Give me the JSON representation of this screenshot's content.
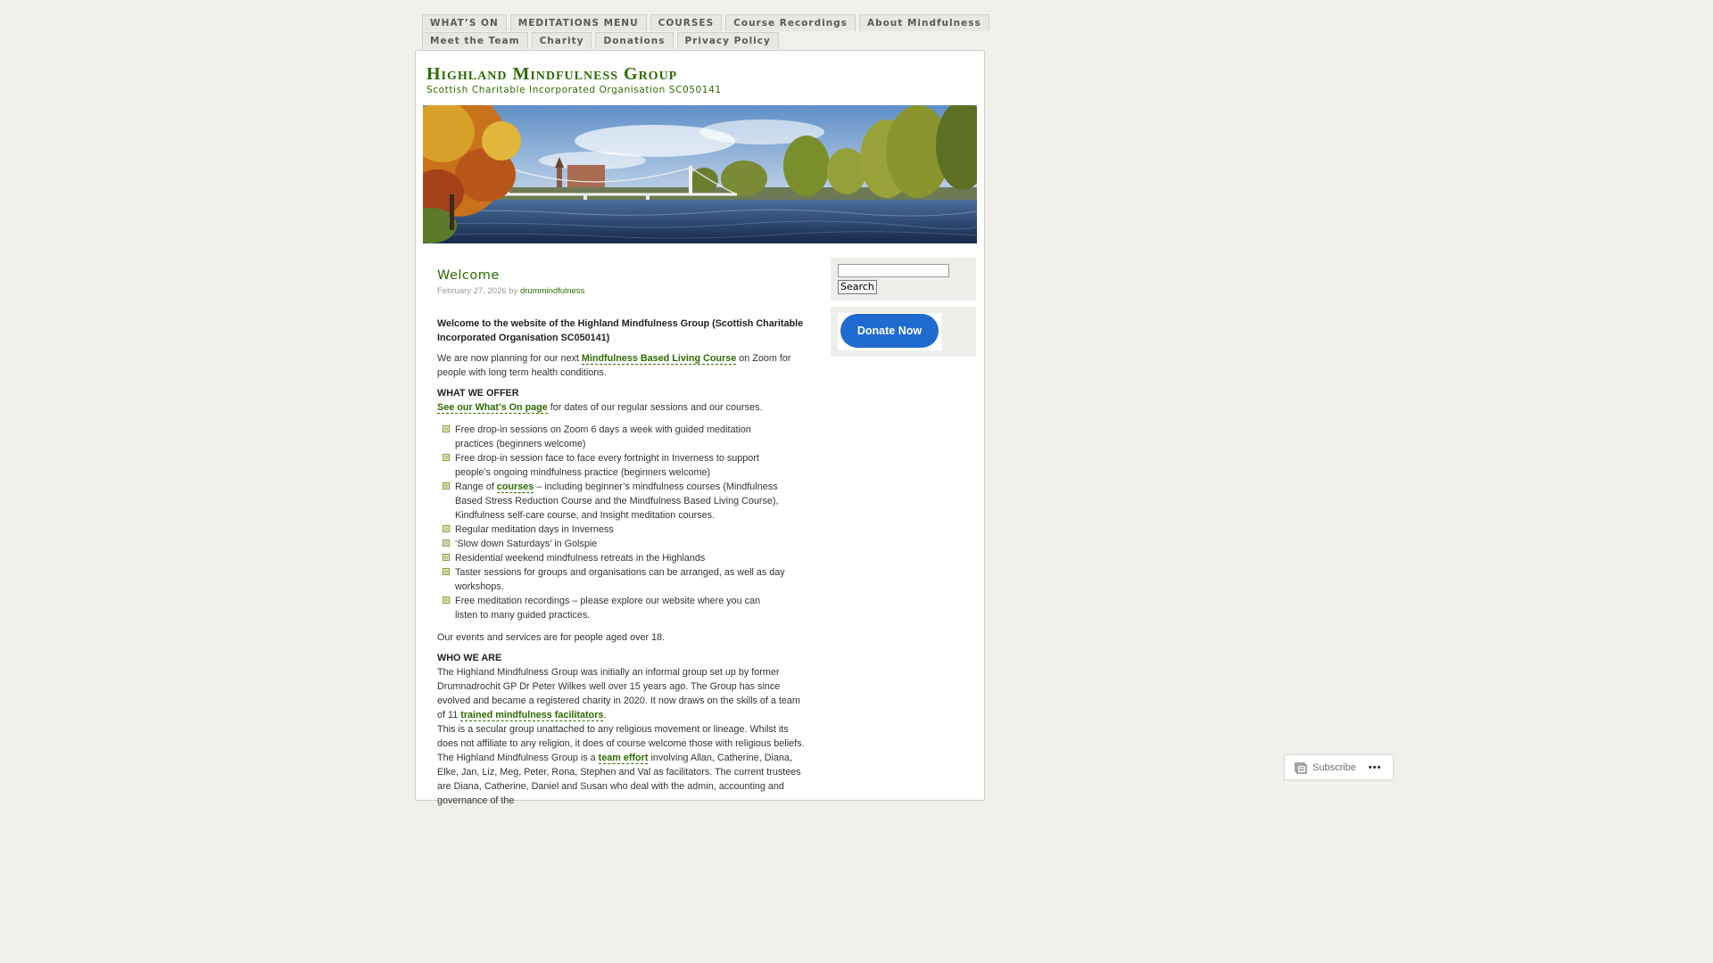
{
  "nav": {
    "row1": [
      "WHAT’S ON",
      "MEDITATIONS MENU",
      "COURSES",
      "Course Recordings",
      "About Mindfulness"
    ],
    "row2": [
      "Meet the Team",
      "Charity",
      "Donations",
      "Privacy Policy"
    ]
  },
  "site": {
    "title": "Highland Mindfulness Group",
    "description": "Scottish Charitable Incorporated Organisation SC050141"
  },
  "post": {
    "title": "Welcome",
    "date": "February 27, 2026",
    "by": "by",
    "author": "drummindfulness",
    "lead": "Welcome to the website of the Highland Mindfulness Group (Scottish Charitable Incorporated Organisation SC050141)",
    "planning_before": "We are now planning for our next ",
    "planning_link": "Mindfulness Based Living Course",
    "planning_after": " on Zoom for people with long term health conditions.",
    "offer_heading": "WHAT WE OFFER",
    "whatson_link": "See our What’s On page",
    "whatson_after": " for dates of our regular sessions and our courses.",
    "offer_items": [
      "Free drop-in sessions on Zoom 6 days a week with guided meditation practices (beginners welcome)",
      "Free drop-in session face to face every fortnight in Inverness to support people’s ongoing mindfulness practice (beginners welcome)",
      "Regular meditation days in Inverness",
      "‘Slow down Saturdays’ in Golspie",
      "Residential weekend mindfulness retreats in the Highlands",
      "Taster sessions for groups and organisations can be arranged, as well as day workshops.",
      "Free meditation recordings – please explore our website where you can listen to many guided practices."
    ],
    "range_before": "Range of ",
    "range_link": "courses",
    "range_after": " – including beginner’s mindfulness courses (Mindfulness Based Stress Reduction Course and the Mindfulness Based Living Course), Kindfulness self-care course, and Insight meditation courses.",
    "age_note": "Our events and services are for people aged over 18.",
    "who_heading": "WHO WE ARE",
    "who_p1_before": "The Highland Mindfulness Group was initially an informal group set up by former Drumnadrochit GP Dr Peter Wilkes well over 15 years ago. The Group has since evolved and became a registered charity in 2020. It now draws on the skills of a team of 11 ",
    "who_p1_link": "trained mindfulness facilitators",
    "who_p1_after": ".",
    "who_p2": "This is a secular group unattached to any religious movement or lineage. Whilst its does not affiliate to any religion, it does of course welcome those with religious beliefs.",
    "who_p3_before": "The Highland Mindfulness Group is a ",
    "who_p3_link": "team effort",
    "who_p3_after": " involving Allan, Catherine, Diana, Elke, Jan, Liz, Meg, Peter, Rona, Stephen and Val as facilitators. The current trustees are Diana, Catherine, Daniel and Susan who deal with the admin, accounting and governance of the"
  },
  "sidebar": {
    "search_button": "Search",
    "search_value": "",
    "donate_label": "Donate Now"
  },
  "subscribe": {
    "label": "Subscribe",
    "more": "•••"
  },
  "colors": {
    "accent": "#2e6b00",
    "donate": "#1f6bd0",
    "background": "#f1f1ec"
  }
}
